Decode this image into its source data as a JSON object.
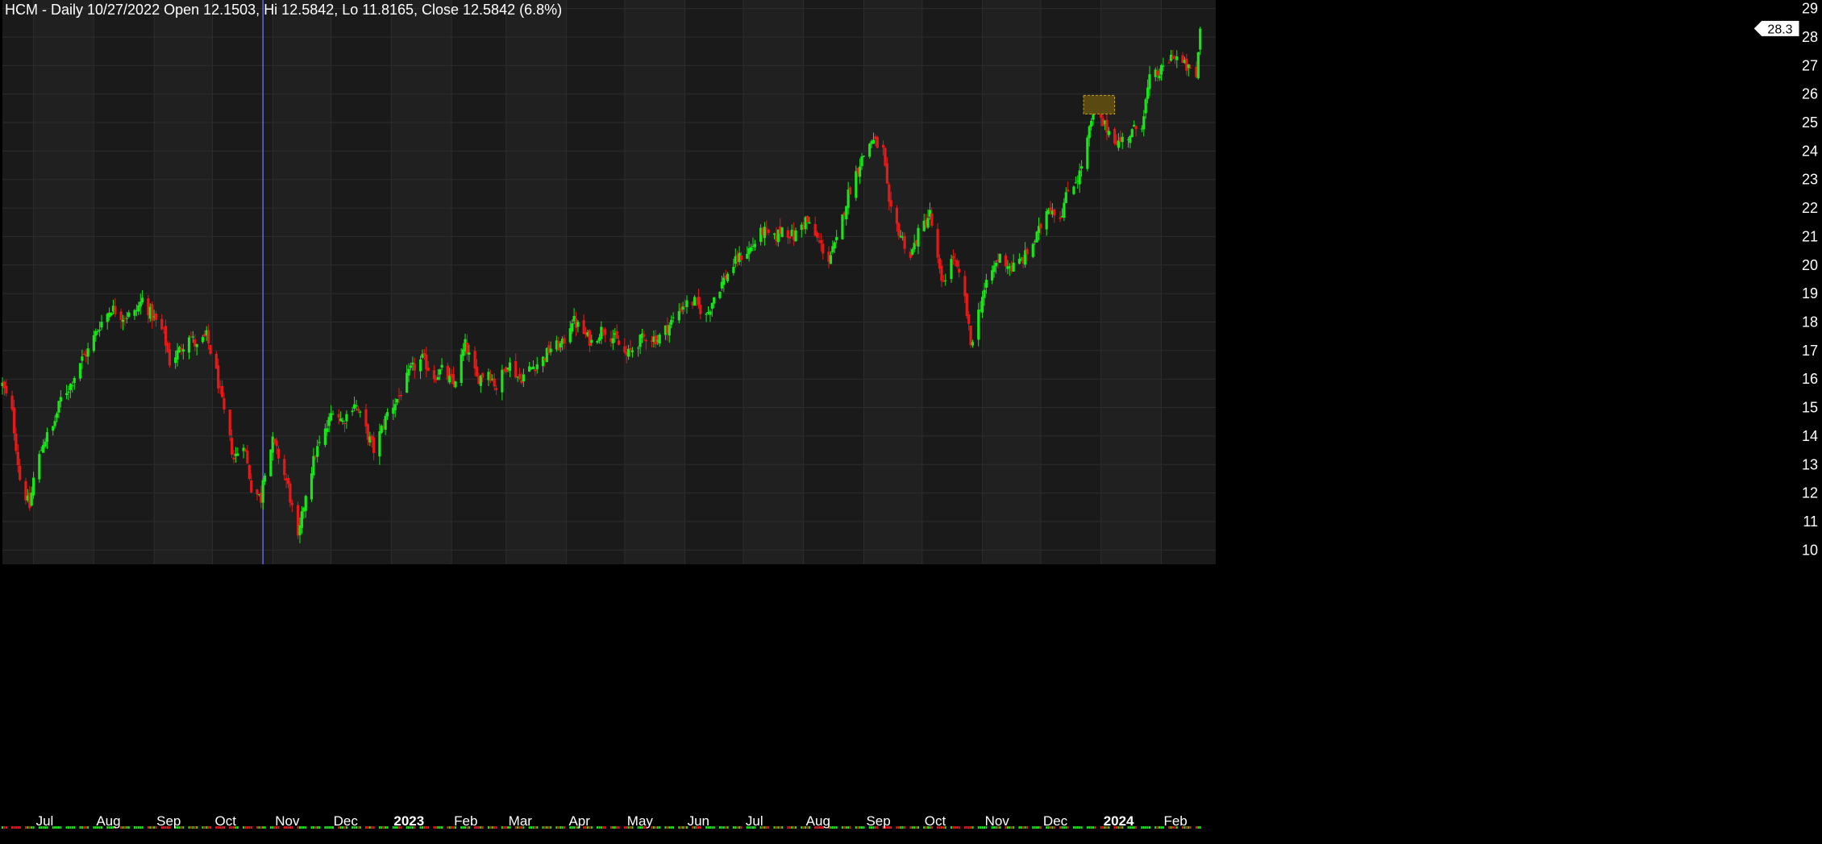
{
  "chart_data": {
    "type": "candlestick",
    "title": "HCM - Daily 10/27/2022 Open 12.1503, Hi 12.5842, Lo 11.8165, Close 12.5842 (6.8%)",
    "symbol": "HCM",
    "interval": "Daily",
    "cursor_date": "10/27/2022",
    "last_price_label": "28.3",
    "ylim": [
      9.5,
      29.3
    ],
    "yticks": [
      10,
      11,
      12,
      13,
      14,
      15,
      16,
      17,
      18,
      19,
      20,
      21,
      22,
      23,
      24,
      25,
      26,
      27,
      28,
      29
    ],
    "x_start": "2022-06-15",
    "x_end": "2024-02-29",
    "month_labels": [
      {
        "label": "Jul",
        "date": "2022-07-01",
        "year": false
      },
      {
        "label": "Aug",
        "date": "2022-08-01",
        "year": false
      },
      {
        "label": "Sep",
        "date": "2022-09-01",
        "year": false
      },
      {
        "label": "Oct",
        "date": "2022-10-01",
        "year": false
      },
      {
        "label": "Nov",
        "date": "2022-11-01",
        "year": false
      },
      {
        "label": "Dec",
        "date": "2022-12-01",
        "year": false
      },
      {
        "label": "2023",
        "date": "2023-01-01",
        "year": true
      },
      {
        "label": "Feb",
        "date": "2023-02-01",
        "year": false
      },
      {
        "label": "Mar",
        "date": "2023-03-01",
        "year": false
      },
      {
        "label": "Apr",
        "date": "2023-04-01",
        "year": false
      },
      {
        "label": "May",
        "date": "2023-05-01",
        "year": false
      },
      {
        "label": "Jun",
        "date": "2023-06-01",
        "year": false
      },
      {
        "label": "Jul",
        "date": "2023-07-01",
        "year": false
      },
      {
        "label": "Aug",
        "date": "2023-08-01",
        "year": false
      },
      {
        "label": "Sep",
        "date": "2023-09-01",
        "year": false
      },
      {
        "label": "Oct",
        "date": "2023-10-01",
        "year": false
      },
      {
        "label": "Nov",
        "date": "2023-11-01",
        "year": false
      },
      {
        "label": "Dec",
        "date": "2023-12-01",
        "year": false
      },
      {
        "label": "2024",
        "date": "2024-01-01",
        "year": true
      },
      {
        "label": "Feb",
        "date": "2024-02-01",
        "year": false
      }
    ],
    "close_anchors": [
      [
        "2022-06-15",
        15.8
      ],
      [
        "2022-06-20",
        14.8
      ],
      [
        "2022-06-24",
        12.5
      ],
      [
        "2022-06-29",
        11.5
      ],
      [
        "2022-07-01",
        12.5
      ],
      [
        "2022-07-06",
        13.8
      ],
      [
        "2022-07-11",
        14.3
      ],
      [
        "2022-07-15",
        15.3
      ],
      [
        "2022-07-20",
        15.8
      ],
      [
        "2022-07-25",
        16.6
      ],
      [
        "2022-07-29",
        17.0
      ],
      [
        "2022-08-04",
        17.9
      ],
      [
        "2022-08-10",
        18.5
      ],
      [
        "2022-08-16",
        18.2
      ],
      [
        "2022-08-22",
        18.3
      ],
      [
        "2022-08-26",
        18.8
      ],
      [
        "2022-08-31",
        18.2
      ],
      [
        "2022-09-06",
        17.6
      ],
      [
        "2022-09-09",
        16.6
      ],
      [
        "2022-09-14",
        17.0
      ],
      [
        "2022-09-19",
        17.6
      ],
      [
        "2022-09-23",
        17.1
      ],
      [
        "2022-09-28",
        17.5
      ],
      [
        "2022-10-03",
        16.2
      ],
      [
        "2022-10-07",
        14.8
      ],
      [
        "2022-10-12",
        13.2
      ],
      [
        "2022-10-17",
        13.8
      ],
      [
        "2022-10-21",
        12.2
      ],
      [
        "2022-10-26",
        11.8
      ],
      [
        "2022-10-27",
        12.58
      ],
      [
        "2022-11-01",
        13.8
      ],
      [
        "2022-11-04",
        13.3
      ],
      [
        "2022-11-09",
        12.2
      ],
      [
        "2022-11-14",
        10.3
      ],
      [
        "2022-11-18",
        12.0
      ],
      [
        "2022-11-23",
        13.4
      ],
      [
        "2022-11-29",
        14.3
      ],
      [
        "2022-12-02",
        15.0
      ],
      [
        "2022-12-07",
        14.5
      ],
      [
        "2022-12-13",
        15.2
      ],
      [
        "2022-12-19",
        14.2
      ],
      [
        "2022-12-23",
        13.5
      ],
      [
        "2022-12-30",
        14.8
      ],
      [
        "2023-01-05",
        15.4
      ],
      [
        "2023-01-11",
        16.3
      ],
      [
        "2023-01-17",
        16.7
      ],
      [
        "2023-01-23",
        16.1
      ],
      [
        "2023-01-27",
        16.3
      ],
      [
        "2023-02-02",
        15.8
      ],
      [
        "2023-02-08",
        17.2
      ],
      [
        "2023-02-14",
        16.0
      ],
      [
        "2023-02-20",
        16.3
      ],
      [
        "2023-02-24",
        15.7
      ],
      [
        "2023-03-02",
        16.6
      ],
      [
        "2023-03-08",
        16.0
      ],
      [
        "2023-03-14",
        16.4
      ],
      [
        "2023-03-20",
        16.7
      ],
      [
        "2023-03-24",
        17.1
      ],
      [
        "2023-03-30",
        17.2
      ],
      [
        "2023-04-04",
        18.1
      ],
      [
        "2023-04-10",
        17.6
      ],
      [
        "2023-04-14",
        17.3
      ],
      [
        "2023-04-20",
        17.8
      ],
      [
        "2023-04-26",
        17.4
      ],
      [
        "2023-05-02",
        16.8
      ],
      [
        "2023-05-08",
        17.3
      ],
      [
        "2023-05-12",
        17.5
      ],
      [
        "2023-05-18",
        17.4
      ],
      [
        "2023-05-24",
        17.9
      ],
      [
        "2023-05-31",
        18.6
      ],
      [
        "2023-06-06",
        18.7
      ],
      [
        "2023-06-12",
        18.2
      ],
      [
        "2023-06-16",
        18.9
      ],
      [
        "2023-06-22",
        19.6
      ],
      [
        "2023-06-28",
        20.2
      ],
      [
        "2023-07-05",
        20.6
      ],
      [
        "2023-07-11",
        21.2
      ],
      [
        "2023-07-17",
        20.9
      ],
      [
        "2023-07-21",
        21.3
      ],
      [
        "2023-07-27",
        21.0
      ],
      [
        "2023-08-02",
        21.6
      ],
      [
        "2023-08-08",
        20.9
      ],
      [
        "2023-08-14",
        20.2
      ],
      [
        "2023-08-18",
        20.8
      ],
      [
        "2023-08-24",
        22.5
      ],
      [
        "2023-08-30",
        23.6
      ],
      [
        "2023-09-05",
        24.4
      ],
      [
        "2023-09-11",
        24.0
      ],
      [
        "2023-09-14",
        22.0
      ],
      [
        "2023-09-19",
        21.2
      ],
      [
        "2023-09-25",
        20.3
      ],
      [
        "2023-09-29",
        21.1
      ],
      [
        "2023-10-05",
        21.8
      ],
      [
        "2023-10-11",
        19.3
      ],
      [
        "2023-10-17",
        20.3
      ],
      [
        "2023-10-23",
        18.8
      ],
      [
        "2023-10-26",
        17.2
      ],
      [
        "2023-11-01",
        18.9
      ],
      [
        "2023-11-06",
        19.8
      ],
      [
        "2023-11-10",
        20.3
      ],
      [
        "2023-11-16",
        19.9
      ],
      [
        "2023-11-22",
        20.2
      ],
      [
        "2023-11-29",
        21.0
      ],
      [
        "2023-12-05",
        22.1
      ],
      [
        "2023-12-11",
        21.7
      ],
      [
        "2023-12-15",
        22.6
      ],
      [
        "2023-12-21",
        23.2
      ],
      [
        "2023-12-28",
        25.3
      ],
      [
        "2024-01-04",
        24.8
      ],
      [
        "2024-01-10",
        24.3
      ],
      [
        "2024-01-16",
        24.6
      ],
      [
        "2024-01-22",
        25.0
      ],
      [
        "2024-01-26",
        26.5
      ],
      [
        "2024-02-01",
        26.8
      ],
      [
        "2024-02-07",
        27.4
      ],
      [
        "2024-02-13",
        27.0
      ],
      [
        "2024-02-19",
        26.6
      ],
      [
        "2024-02-21",
        28.3
      ]
    ],
    "volume_strip": true,
    "grid": true,
    "colors": {
      "background": "#000000",
      "panel": "#1a1a1a",
      "band_alt": "#202020",
      "grid": "#2c2c2c",
      "up": "#19e619",
      "down": "#e61919",
      "cursor_line": "#6a6ad0",
      "axis_text": "#ffffff",
      "last_label_bg": "#ffffff",
      "highlight_fill": "#5a4a12",
      "highlight_border": "#c8a020"
    }
  }
}
